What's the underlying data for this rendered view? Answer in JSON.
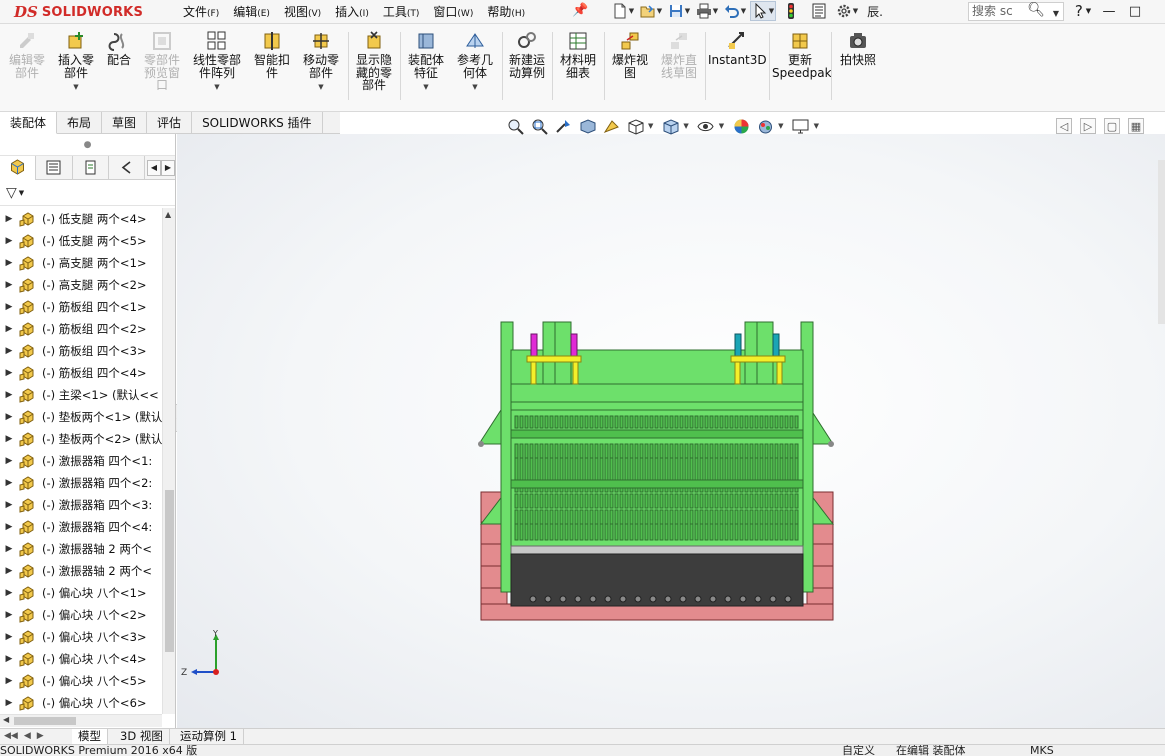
{
  "app": {
    "logo_ds": "DS",
    "logo_text": "SOLIDWORKS"
  },
  "menu": [
    {
      "label": "文件",
      "key": "(F)"
    },
    {
      "label": "编辑",
      "key": "(E)"
    },
    {
      "label": "视图",
      "key": "(V)"
    },
    {
      "label": "插入",
      "key": "(I)"
    },
    {
      "label": "工具",
      "key": "(T)"
    },
    {
      "label": "窗口",
      "key": "(W)"
    },
    {
      "label": "帮助",
      "key": "(H)"
    }
  ],
  "quick_access": {
    "rebuild_truncated": "辰.",
    "search_placeholder": "搜索 sc",
    "help": "?"
  },
  "ribbon": [
    {
      "label": "编辑零部件",
      "icon": "edit-component-icon",
      "disabled": true
    },
    {
      "label": "插入零部件",
      "icon": "insert-component-icon",
      "disabled": false
    },
    {
      "label": "配合",
      "icon": "mate-icon",
      "disabled": false
    },
    {
      "label": "零部件预览窗口",
      "icon": "component-preview-icon",
      "disabled": true
    },
    {
      "label": "线性零部件阵列",
      "icon": "linear-pattern-icon",
      "disabled": false
    },
    {
      "label": "智能扣件",
      "icon": "smart-fasteners-icon",
      "disabled": false
    },
    {
      "label": "移动零部件",
      "icon": "move-component-icon",
      "disabled": false
    },
    {
      "label": "显示隐藏的零部件",
      "icon": "show-hidden-icon",
      "disabled": false
    },
    {
      "label": "装配体特征",
      "icon": "assembly-feature-icon",
      "disabled": false
    },
    {
      "label": "参考几何体",
      "icon": "reference-geometry-icon",
      "disabled": false
    },
    {
      "label": "新建运动算例",
      "icon": "motion-study-icon",
      "disabled": false
    },
    {
      "label": "材料明细表",
      "icon": "bom-icon",
      "disabled": false
    },
    {
      "label": "爆炸视图",
      "icon": "exploded-view-icon",
      "disabled": false
    },
    {
      "label": "爆炸直线草图",
      "icon": "explode-line-sketch-icon",
      "disabled": true
    },
    {
      "label": "Instant3D",
      "icon": "instant3d-icon",
      "disabled": false
    },
    {
      "label": "更新Speedpak",
      "icon": "speedpak-icon",
      "disabled": false
    },
    {
      "label": "拍快照",
      "icon": "snapshot-icon",
      "disabled": false
    }
  ],
  "cm_tabs": [
    "装配体",
    "布局",
    "草图",
    "评估",
    "SOLIDWORKS 插件"
  ],
  "tree_items": [
    "(-) 低支腿  两个<4>",
    "(-) 低支腿  两个<5>",
    "(-) 高支腿   两个<1>",
    "(-) 高支腿   两个<2>",
    "(-) 筋板组  四个<1>",
    "(-) 筋板组  四个<2>",
    "(-) 筋板组  四个<3>",
    "(-) 筋板组  四个<4>",
    "(-) 主梁<1> (默认<<",
    "(-) 垫板两个<1> (默认",
    "(-) 垫板两个<2> (默认",
    "(-) 激振器箱 四个<1:",
    "(-) 激振器箱 四个<2:",
    "(-) 激振器箱 四个<3:",
    "(-) 激振器箱 四个<4:",
    "(-) 激振器轴 2  两个<",
    "(-) 激振器轴 2  两个<",
    "(-) 偏心块  八个<1>",
    "(-) 偏心块  八个<2>",
    "(-) 偏心块  八个<3>",
    "(-) 偏心块  八个<4>",
    "(-) 偏心块  八个<5>",
    "(-) 偏心块  八个<6>"
  ],
  "bottom_tabs": [
    "模型",
    "3D 视图",
    "运动算例 1"
  ],
  "status": {
    "product": "SOLIDWORKS Premium 2016 x64 版",
    "custom": "自定义",
    "mode": "在编辑 装配体",
    "units": "MKS"
  },
  "triad": {
    "y": "Y",
    "z": "Z"
  },
  "colors": {
    "frame_green": "#6de06b",
    "frame_dark": "#2f6e2f",
    "base_red": "#e38b8e",
    "hopper_dark": "#3d3d3d",
    "magenta": "#e02ad6",
    "cyan": "#1aa5b5",
    "yellow": "#f4ef2a",
    "brand_red": "#d12b28"
  }
}
